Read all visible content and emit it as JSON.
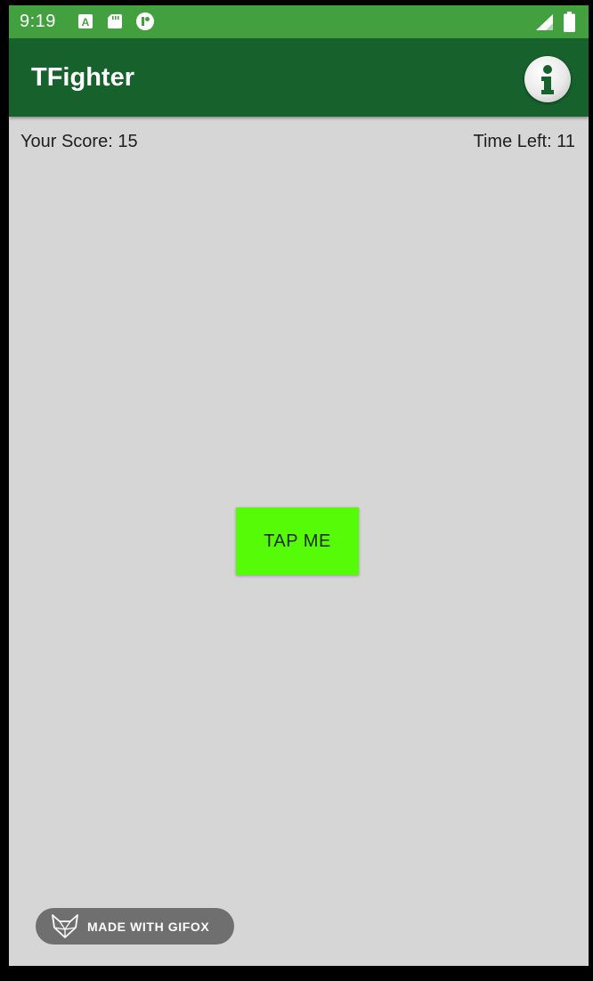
{
  "status_bar": {
    "time": "9:19",
    "notification_icons": [
      "a-app-icon",
      "sd-card-icon",
      "app-notification-icon"
    ],
    "right_icons": [
      "signal-icon",
      "battery-icon"
    ]
  },
  "app_bar": {
    "title": "TFighter",
    "info_icon": "info-icon"
  },
  "game": {
    "score_label": "Your Score: 15",
    "time_left_label": "Time Left: 11",
    "tap_button_label": "TAP ME"
  },
  "watermark": {
    "text": "MADE WITH GIFOX",
    "icon": "fox-icon"
  },
  "colors": {
    "status_bar": "#43a03f",
    "app_bar": "#17622c",
    "background": "#d6d6d6",
    "tap_button": "#55fb07",
    "badge": "#6f6f6f"
  }
}
